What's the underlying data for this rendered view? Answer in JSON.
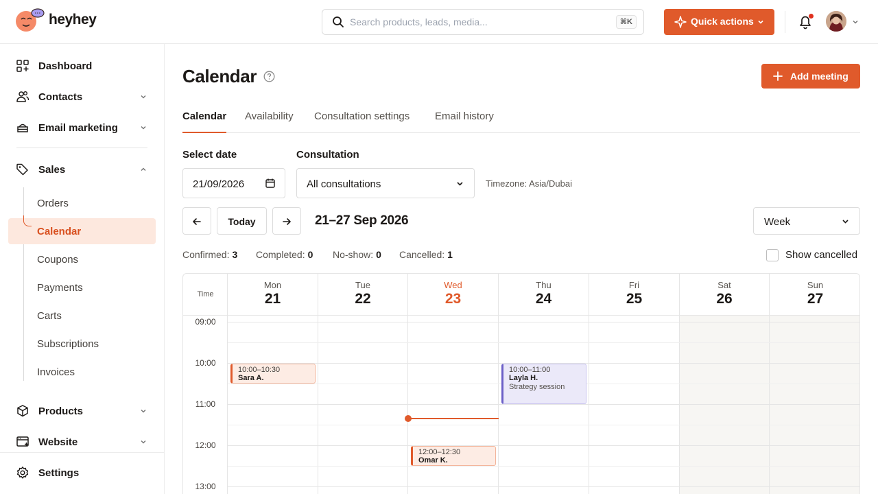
{
  "app": {
    "name": "heyhey"
  },
  "topbar": {
    "search_placeholder": "Search products, leads, media...",
    "search_shortcut": "⌘K",
    "quick_actions_label": "Quick actions",
    "notification_color": "#e0301e"
  },
  "colors": {
    "accent": "#e05a2b",
    "accent_light": "#fde8de",
    "event_purple": "#6b5fc7"
  },
  "sidebar": {
    "items": [
      {
        "label": "Dashboard",
        "icon": "dashboard-icon"
      },
      {
        "label": "Contacts",
        "icon": "contacts-icon",
        "expandable": true
      },
      {
        "label": "Email marketing",
        "icon": "email-marketing-icon",
        "expandable": true
      },
      {
        "label": "Sales",
        "icon": "tag-icon",
        "expanded": true
      },
      {
        "label": "Products",
        "icon": "box-icon",
        "expandable": true
      },
      {
        "label": "Website",
        "icon": "website-icon",
        "expandable": true
      },
      {
        "label": "Settings",
        "icon": "gear-icon"
      }
    ],
    "sales_sub": [
      "Orders",
      "Calendar",
      "Coupons",
      "Payments",
      "Carts",
      "Subscriptions",
      "Invoices"
    ],
    "active_sub": "Calendar"
  },
  "page": {
    "title": "Calendar",
    "add_button": "Add meeting",
    "tabs": [
      "Calendar",
      "Availability",
      "Consultation settings",
      "Email history"
    ],
    "active_tab": "Calendar"
  },
  "filters": {
    "date_label": "Select date",
    "date_value": "21/09/2026",
    "consultation_label": "Consultation",
    "consultation_value": "All consultations",
    "timezone": "Timezone: Asia/Dubai"
  },
  "toolbar": {
    "today_label": "Today",
    "range": "21–27 Sep 2026",
    "view": "Week"
  },
  "stats": {
    "confirmed_label": "Confirmed:",
    "confirmed": "3",
    "completed_label": "Completed:",
    "completed": "0",
    "noshow_label": "No-show:",
    "noshow": "0",
    "cancelled_label": "Cancelled:",
    "cancelled": "1",
    "show_cancelled_label": "Show cancelled",
    "show_cancelled_checked": false
  },
  "calendar": {
    "time_header": "Time",
    "days": [
      {
        "name": "Mon",
        "date": "21"
      },
      {
        "name": "Tue",
        "date": "22"
      },
      {
        "name": "Wed",
        "date": "23",
        "today": true
      },
      {
        "name": "Thu",
        "date": "24"
      },
      {
        "name": "Fri",
        "date": "25"
      },
      {
        "name": "Sat",
        "date": "26",
        "weekend": true
      },
      {
        "name": "Sun",
        "date": "27",
        "weekend": true
      }
    ],
    "times": [
      "09:00",
      "10:00",
      "11:00",
      "12:00",
      "13:00"
    ],
    "events": [
      {
        "day": "Mon",
        "time": "10:00–10:30",
        "name": "Sara A.",
        "color": "orange"
      },
      {
        "day": "Thu",
        "time": "10:00–11:00",
        "name": "Layla H.",
        "desc": "Strategy session",
        "color": "purple"
      },
      {
        "day": "Wed",
        "time": "12:00–12:30",
        "name": "Omar K.",
        "color": "orange"
      }
    ],
    "current_time_day": "Wed"
  }
}
